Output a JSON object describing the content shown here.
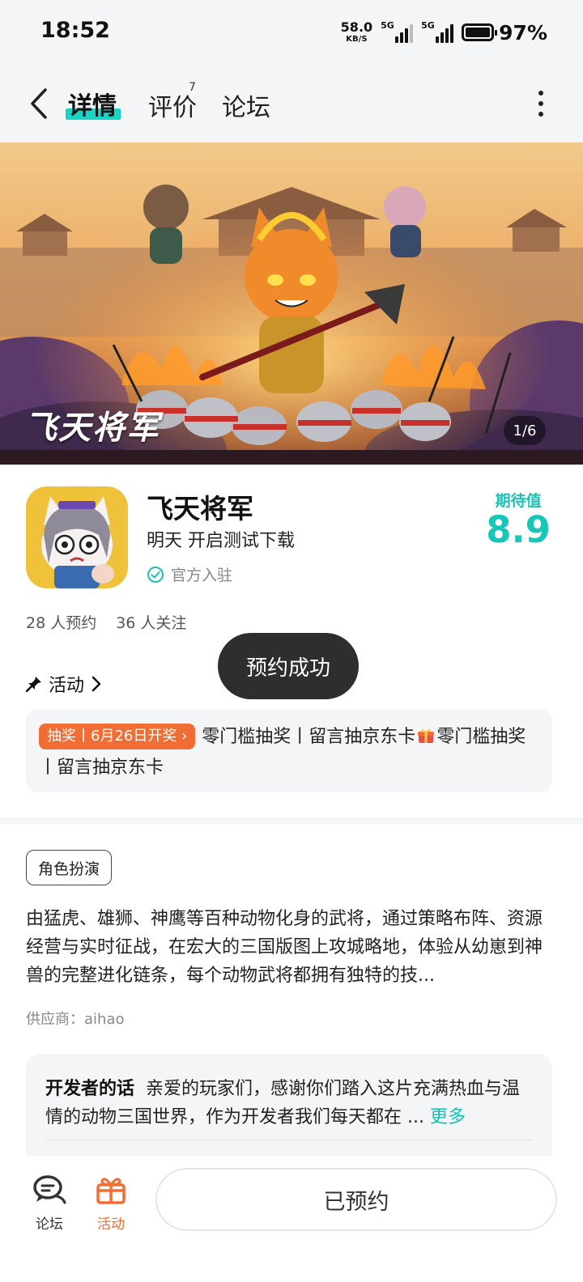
{
  "status_bar": {
    "time": "18:52",
    "net_speed_value": "58.0",
    "net_speed_unit": "KB/S",
    "signal1_label": "5G",
    "signal2_label": "5G",
    "battery_percent": "97%"
  },
  "nav": {
    "tabs": [
      {
        "label": "详情",
        "active": true
      },
      {
        "label": "评价",
        "badge": "7"
      },
      {
        "label": "论坛"
      }
    ]
  },
  "banner": {
    "counter": "1/6",
    "logo_text": "飞天将军"
  },
  "app": {
    "name": "飞天将军",
    "subtitle": "明天 开启测试下载",
    "official_label": "官方入驻",
    "expect_label": "期待值",
    "expect_value": "8.9",
    "reservations": "28 人预约",
    "followers": "36 人关注"
  },
  "activity": {
    "title": "活动",
    "lottery_tag": "抽奖丨6月26日开奖",
    "text_part1": "零门槛抽奖丨留言抽京东卡",
    "text_part2": "零门槛抽奖丨留言抽京东卡"
  },
  "toast": {
    "text": "预约成功"
  },
  "details": {
    "genre": "角色扮演",
    "description": "由猛虎、雄狮、神鹰等百种动物化身的武将，通过策略布阵、资源经营与实时征战，在宏大的三国版图上攻城略地，体验从幼崽到神兽的完整进化链条，每个动物武将都拥有独特的技...",
    "supplier": "供应商：aihao"
  },
  "developer": {
    "title": "开发者的话",
    "text": "亲爱的玩家们，感谢你们踏入这片充满热血与温情的动物三国世界，作为开发者我们每天都在 ...",
    "more": "更多"
  },
  "bottom": {
    "forum_label": "论坛",
    "activity_label": "活动",
    "reserved_label": "已预约"
  },
  "colors": {
    "accent": "#19d3c5",
    "orange": "#f26d34",
    "toast_bg": "#2e2e2e"
  }
}
